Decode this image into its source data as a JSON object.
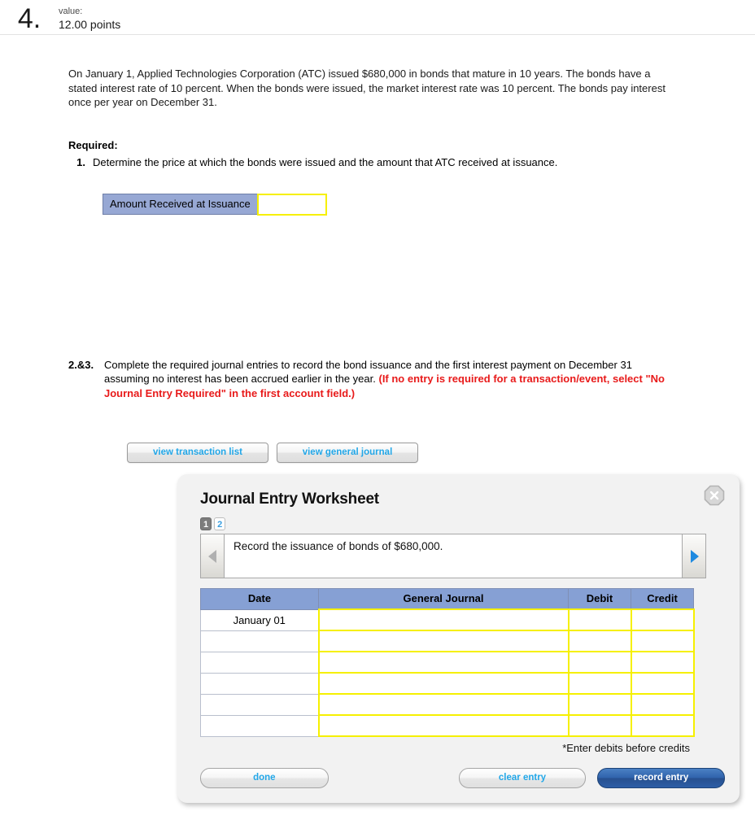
{
  "question": {
    "number": "4.",
    "value_label": "value:",
    "points": "12.00 points",
    "problem_text": "On January 1, Applied Technologies Corporation (ATC) issued $680,000 in bonds that mature in 10 years. The bonds have a stated interest rate of 10 percent. When the bonds were issued, the market interest rate was 10 percent. The bonds pay interest once per year on December 31."
  },
  "required": {
    "heading": "Required:",
    "items": [
      {
        "number": "1.",
        "text": "Determine the price at which the bonds were issued and the amount that ATC received at issuance."
      }
    ]
  },
  "amount_table": {
    "label": "Amount Received at Issuance",
    "value": "",
    "placeholder": ""
  },
  "section23": {
    "number": "2.&3.",
    "text_plain": "Complete the required journal entries to record the bond issuance and the first interest payment on December 31 assuming no interest has been accrued earlier in the year. ",
    "text_red": "(If no entry is required for a transaction/event, select \"No Journal Entry Required\" in the first account field.)"
  },
  "view_buttons": {
    "transaction_list": "view transaction list",
    "general_journal": "view general journal"
  },
  "worksheet": {
    "title": "Journal Entry Worksheet",
    "close_icon": "close-icon",
    "pager": [
      {
        "label": "1",
        "state": "active"
      },
      {
        "label": "2",
        "state": "inactive"
      }
    ],
    "nav": {
      "prev_icon": "arrow-left-icon",
      "next_icon": "arrow-right-icon"
    },
    "instruction": "Record the issuance of bonds of $680,000.",
    "table": {
      "headers": [
        "Date",
        "General Journal",
        "Debit",
        "Credit"
      ],
      "rows": [
        {
          "date": "January 01",
          "general_journal": "",
          "debit": "",
          "credit": ""
        },
        {
          "date": "",
          "general_journal": "",
          "debit": "",
          "credit": ""
        },
        {
          "date": "",
          "general_journal": "",
          "debit": "",
          "credit": ""
        },
        {
          "date": "",
          "general_journal": "",
          "debit": "",
          "credit": ""
        },
        {
          "date": "",
          "general_journal": "",
          "debit": "",
          "credit": ""
        },
        {
          "date": "",
          "general_journal": "",
          "debit": "",
          "credit": ""
        }
      ]
    },
    "note": "*Enter debits before credits",
    "buttons": {
      "done": "done",
      "clear_entry": "clear entry",
      "record_entry": "record entry"
    }
  },
  "colors": {
    "header_blue": "#86a0d4",
    "label_blue": "#97a8d4",
    "editable_yellow": "#f6f000",
    "link_blue": "#22a7e8",
    "alert_red": "#e81a1a",
    "record_blue": "#2f62ab"
  }
}
